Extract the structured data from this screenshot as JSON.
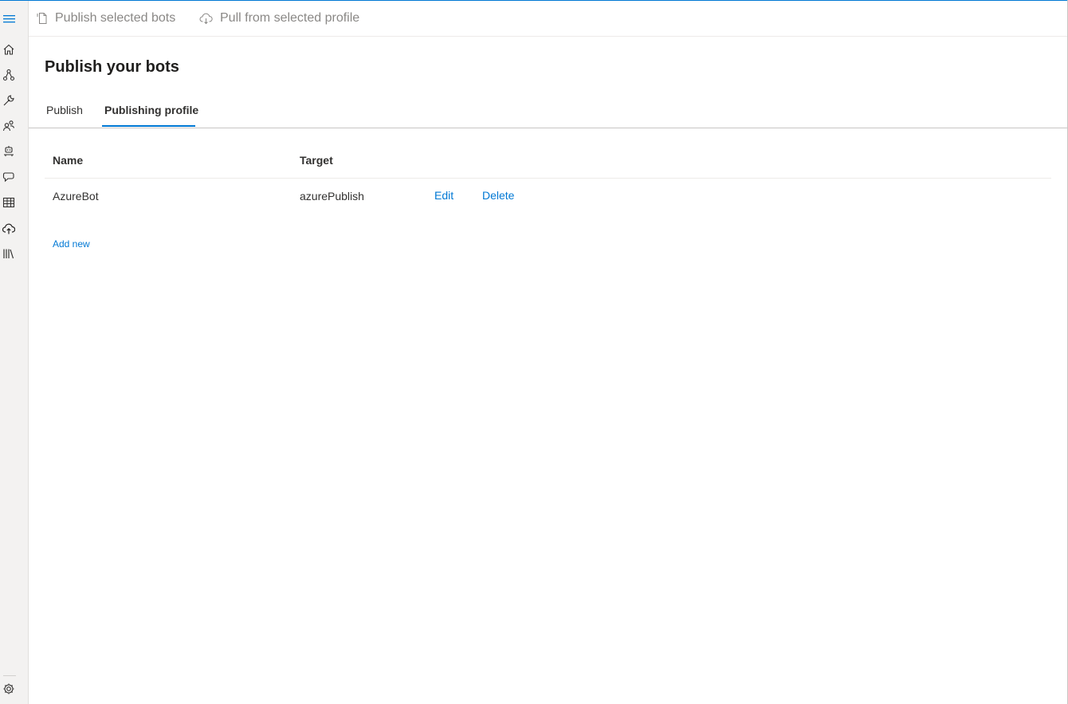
{
  "toolbar": {
    "publish_selected_label": "Publish selected bots",
    "pull_from_profile_label": "Pull from selected profile"
  },
  "page": {
    "title": "Publish your bots"
  },
  "tabs": [
    {
      "label": "Publish",
      "active": false
    },
    {
      "label": "Publishing profile",
      "active": true
    }
  ],
  "table": {
    "columns": [
      "Name",
      "Target"
    ],
    "rows": [
      {
        "name": "AzureBot",
        "target": "azurePublish",
        "edit_label": "Edit",
        "delete_label": "Delete"
      }
    ]
  },
  "add_new_label": "Add new",
  "sidebar": {
    "items": [
      {
        "icon": "hamburger-menu-icon"
      },
      {
        "icon": "home-icon"
      },
      {
        "icon": "bot-flow-icon"
      },
      {
        "icon": "wrench-icon"
      },
      {
        "icon": "users-icon"
      },
      {
        "icon": "bot-responses-icon"
      },
      {
        "icon": "chat-icon"
      },
      {
        "icon": "table-icon"
      },
      {
        "icon": "cloud-upload-icon"
      },
      {
        "icon": "library-icon"
      },
      {
        "icon": "settings-gear-icon"
      }
    ]
  },
  "colors": {
    "accent": "#0078d4",
    "sidebar_bg": "#f3f2f1",
    "text": "#323130",
    "disabled_text": "#8a8886"
  }
}
